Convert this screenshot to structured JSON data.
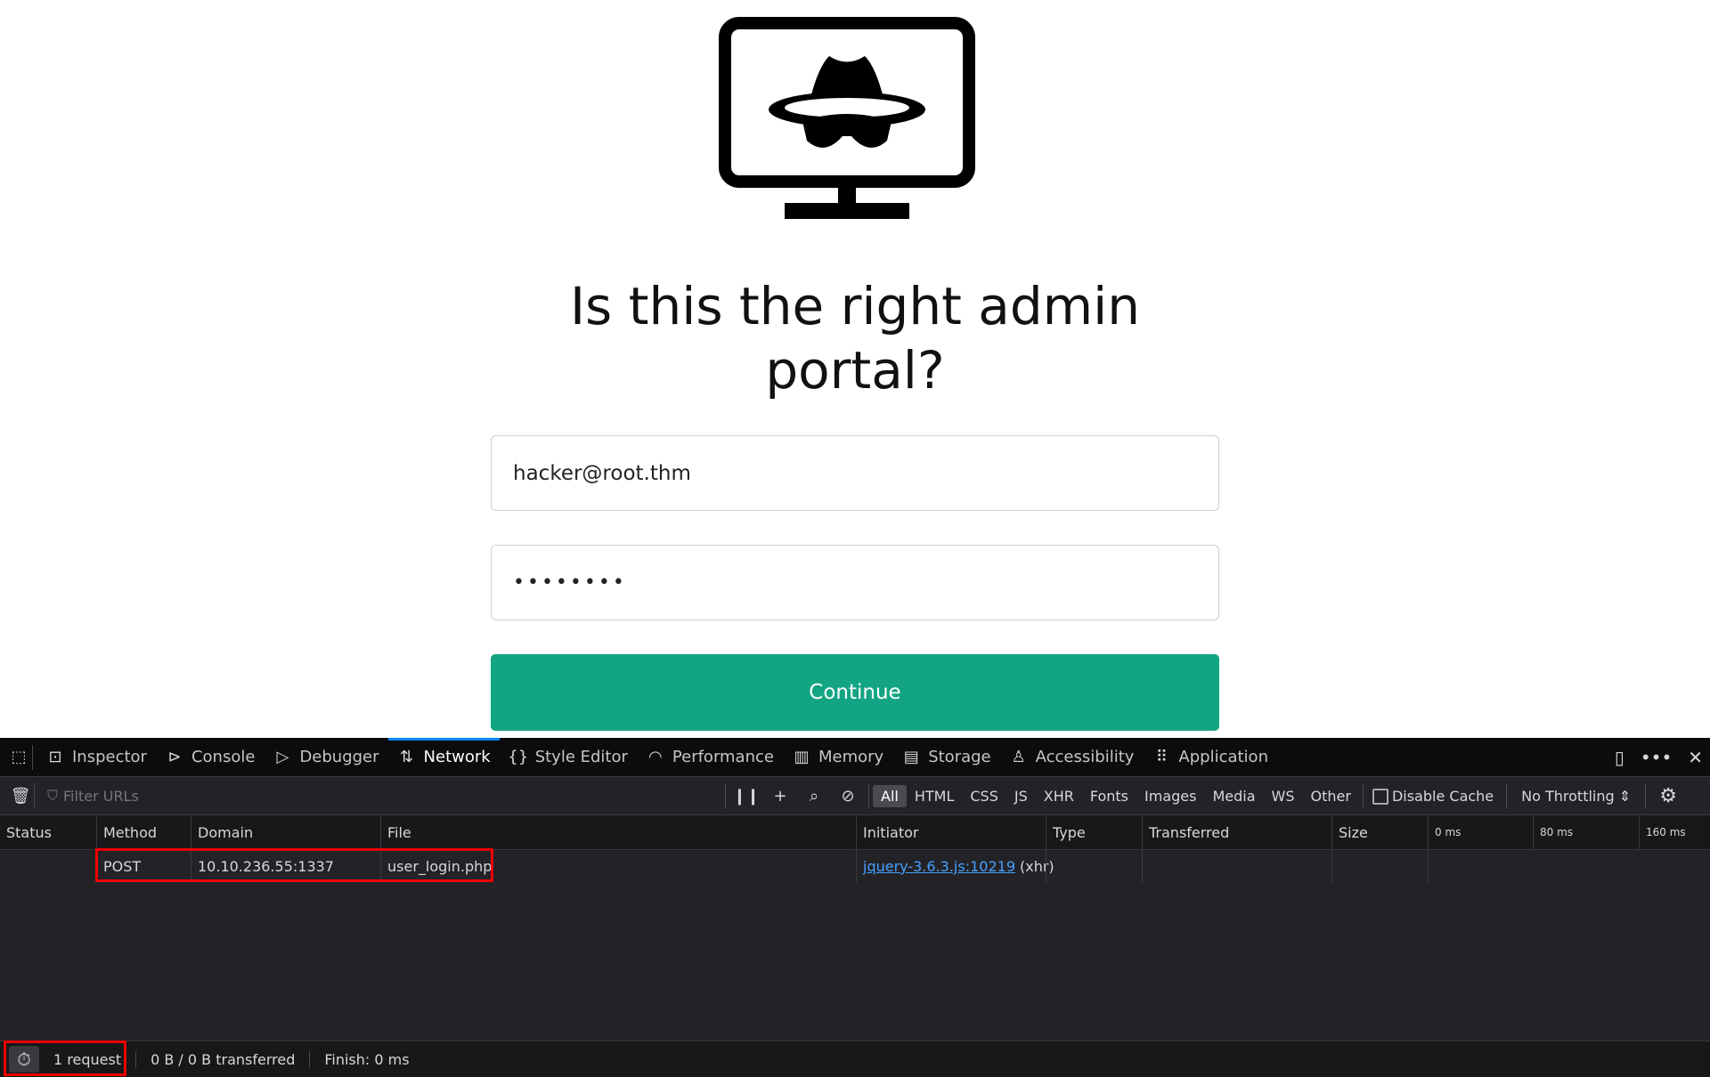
{
  "page": {
    "heading": "Is this the right admin portal?",
    "email_value": "hacker@root.thm",
    "password_value": "••••••••",
    "continue_label": "Continue"
  },
  "devtools": {
    "tabs": [
      {
        "label": "Inspector",
        "icon": "inspector-icon"
      },
      {
        "label": "Console",
        "icon": "console-icon"
      },
      {
        "label": "Debugger",
        "icon": "debugger-icon"
      },
      {
        "label": "Network",
        "icon": "network-icon"
      },
      {
        "label": "Style Editor",
        "icon": "style-editor-icon"
      },
      {
        "label": "Performance",
        "icon": "performance-icon"
      },
      {
        "label": "Memory",
        "icon": "memory-icon"
      },
      {
        "label": "Storage",
        "icon": "storage-icon"
      },
      {
        "label": "Accessibility",
        "icon": "accessibility-icon"
      },
      {
        "label": "Application",
        "icon": "application-icon"
      }
    ],
    "active_tab": "Network",
    "filter_placeholder": "Filter URLs",
    "type_filters": [
      "All",
      "HTML",
      "CSS",
      "JS",
      "XHR",
      "Fonts",
      "Images",
      "Media",
      "WS",
      "Other"
    ],
    "disable_cache": "Disable Cache",
    "throttling": "No Throttling",
    "columns": [
      "Status",
      "Method",
      "Domain",
      "File",
      "Initiator",
      "Type",
      "Transferred",
      "Size"
    ],
    "timeline": [
      "0 ms",
      "80 ms",
      "160 ms"
    ],
    "rows": [
      {
        "status": "",
        "method": "POST",
        "domain": "10.10.236.55:1337",
        "file": "user_login.php",
        "initiator_link": "jquery-3.6.3.js:10219",
        "initiator_type": "(xhr)",
        "type": "",
        "transferred": "",
        "size": ""
      }
    ],
    "status": {
      "requests": "1 request",
      "transferred": "0 B / 0 B transferred",
      "finish": "Finish: 0 ms"
    },
    "colors": {
      "accent": "#0a84ff",
      "highlight": "#ee0000",
      "button": "#13a583"
    }
  }
}
